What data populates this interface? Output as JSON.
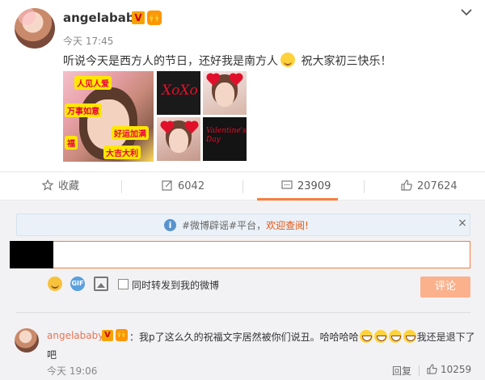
{
  "post": {
    "username": "angelababy",
    "vip_badge": "V",
    "fans_badge": "🙌",
    "time": "今天 17:45",
    "text_before_emoji": "听说今天是西方人的节日，还好我是南方人",
    "text_after_emoji": " 祝大家初三快乐！",
    "images": {
      "large_stickers": [
        "人见人爱",
        "万事如意",
        "好运加满",
        "福",
        "大吉大利"
      ],
      "xoxo": "XoXo",
      "valentines": "Valentine's Day"
    }
  },
  "actions": {
    "favorite_label": "收藏",
    "repost_count": "6042",
    "comment_count": "23909",
    "like_count": "207624"
  },
  "notice": {
    "prefix": "#微博辟谣#平台，",
    "link": "欢迎查阅!",
    "close": "×"
  },
  "reply_form": {
    "sync_label": "同时转发到我的微博",
    "submit_label": "评论",
    "gif_label": "GIF"
  },
  "comment": {
    "username": "angelababy",
    "vip_badge": "V",
    "fans_badge": "🙌",
    "text_start": "：我p了这么久的祝福文字居然被你们说丑。哈哈哈哈",
    "text_end": "我还是退下了吧",
    "time": "今天 19:06",
    "reply_label": "回复",
    "like_count": "10259"
  },
  "colors": {
    "accent": "#fa7d3c",
    "link": "#eb7350",
    "notice_bg": "#eaf1f8",
    "submit_disabled": "#fbb18c"
  }
}
